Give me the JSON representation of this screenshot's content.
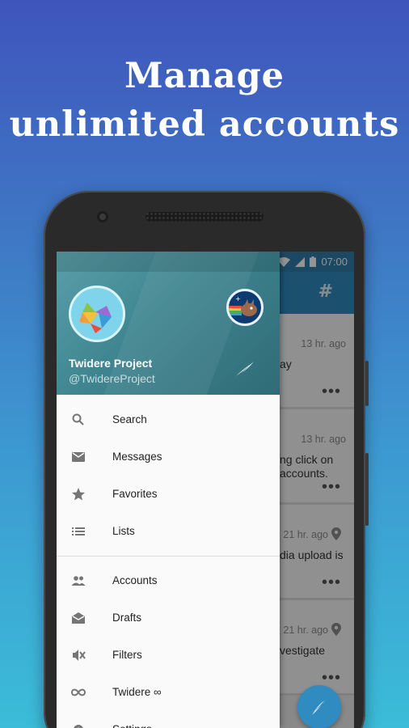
{
  "headline": {
    "line1": "Manage",
    "line2": "unlimited accounts"
  },
  "status_bar": {
    "time": "07:00"
  },
  "app_bar": {
    "tab_label": "#"
  },
  "drawer": {
    "account_name": "Twidere Project",
    "account_handle": "@TwidereProject",
    "menu_top": [
      {
        "label": "Search",
        "icon": "search-icon"
      },
      {
        "label": "Messages",
        "icon": "mail-icon"
      },
      {
        "label": "Favorites",
        "icon": "star-icon"
      },
      {
        "label": "Lists",
        "icon": "list-icon"
      }
    ],
    "menu_bottom": [
      {
        "label": "Accounts",
        "icon": "people-icon"
      },
      {
        "label": "Drafts",
        "icon": "drafts-icon"
      },
      {
        "label": "Filters",
        "icon": "filter-mute-icon"
      },
      {
        "label": "Twidere ∞",
        "icon": "infinity-icon"
      },
      {
        "label": "Settings",
        "icon": "settings-icon"
      }
    ]
  },
  "feed": [
    {
      "time": "13 hr. ago",
      "snippet_lines": [
        "ay",
        ""
      ],
      "has_pin": false
    },
    {
      "time": "13 hr. ago",
      "snippet_lines": [
        "ng click on",
        "accounts."
      ],
      "has_pin": false
    },
    {
      "time": "21 hr. ago",
      "snippet_lines": [
        "dia upload is",
        ""
      ],
      "has_pin": true
    },
    {
      "time": "21 hr. ago",
      "snippet_lines": [
        "vestigate",
        ""
      ],
      "has_pin": true
    }
  ],
  "colors": {
    "accent": "#2f8bc0",
    "drawer_header": "#3f8590",
    "background_top": "#3f55bd",
    "background_bottom": "#3bbcd8"
  }
}
